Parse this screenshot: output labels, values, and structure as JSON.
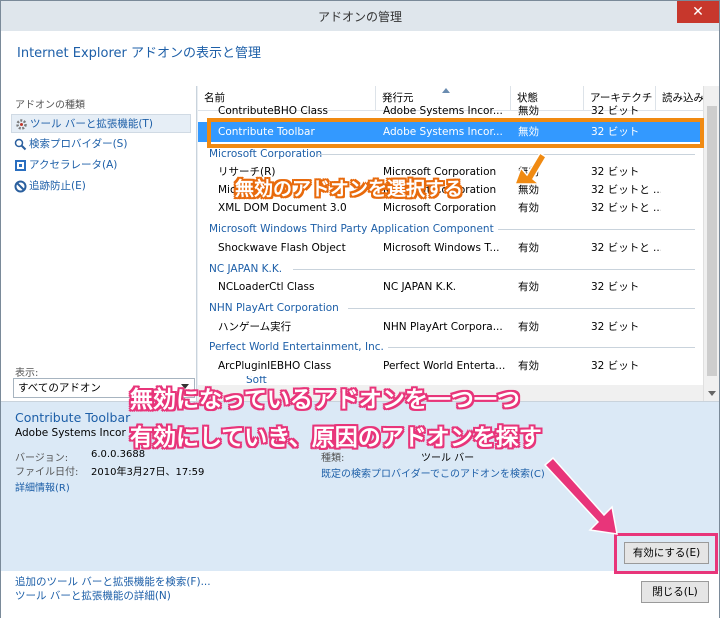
{
  "window": {
    "title": "アドオンの管理",
    "close_glyph": "✕"
  },
  "header": {
    "title": "Internet Explorer アドオンの表示と管理"
  },
  "left_pane": {
    "types_label": "アドオンの種類",
    "types": [
      {
        "label": "ツール バーと拡張機能(T)",
        "icon": "gear-icon",
        "selected": true
      },
      {
        "label": "検索プロバイダー(S)",
        "icon": "search-icon",
        "selected": false
      },
      {
        "label": "アクセラレータ(A)",
        "icon": "accelerator-icon",
        "selected": false
      },
      {
        "label": "追跡防止(E)",
        "icon": "block-icon",
        "selected": false
      }
    ],
    "show_label": "表示:",
    "show_value": "すべてのアドオン"
  },
  "columns": {
    "name": "名前",
    "publisher": "発行元",
    "status": "状態",
    "arch": "アーキテクチャ",
    "load": "読み込み"
  },
  "list": {
    "partial_row": {
      "name": "ContributeBHO Class",
      "publisher": "Adobe Systems Incor...",
      "status": "無効",
      "arch": "32 ビット"
    },
    "selected_row": {
      "name": "Contribute Toolbar",
      "publisher": "Adobe Systems Incor...",
      "status": "無効",
      "arch": "32 ビット"
    },
    "groups": [
      {
        "name": "Microsoft Corporation",
        "rows": [
          {
            "name": "リサーチ(R)",
            "publisher": "Microsoft Corporation",
            "status": "無効",
            "arch": "32 ビット"
          },
          {
            "name": "Mic",
            "publisher": "Microsoft Corporation",
            "status": "無効",
            "arch": "32 ビットと ..."
          },
          {
            "name": "XML DOM Document 3.0",
            "publisher": "Microsoft Corporation",
            "status": "有効",
            "arch": "32 ビットと ..."
          }
        ]
      },
      {
        "name": "Microsoft Windows Third Party Application Component",
        "rows": [
          {
            "name": "Shockwave Flash Object",
            "publisher": "Microsoft Windows T...",
            "status": "有効",
            "arch": "32 ビットと ..."
          }
        ]
      },
      {
        "name": "NC JAPAN K.K.",
        "rows": [
          {
            "name": "NCLoaderCtl Class",
            "publisher": "NC JAPAN K.K.",
            "status": "有効",
            "arch": "32 ビット"
          }
        ]
      },
      {
        "name": "NHN PlayArt Corporation",
        "rows": [
          {
            "name": "ハンゲーム実行",
            "publisher": "NHN PlayArt Corpora...",
            "status": "有効",
            "arch": "32 ビット"
          }
        ]
      },
      {
        "name": "Perfect World Entertainment, Inc.",
        "rows": [
          {
            "name": "ArcPluginIEBHO Class",
            "publisher": "Perfect World Enterta...",
            "status": "有効",
            "arch": "32 ビット"
          }
        ]
      }
    ],
    "partial_bottom": "Soft"
  },
  "details": {
    "name": "Contribute Toolbar",
    "publisher": "Adobe Systems Incor",
    "version_label": "バージョン:",
    "version_value": "6.0.0.3688",
    "date_label": "ファイル日付:",
    "date_value": "2010年3月27日、17:59",
    "more_info": "詳細情報(R)",
    "type_label": "種類:",
    "type_value": "ツール バー",
    "search_link": "既定の検索プロバイダーでこのアドオンを検索(C)"
  },
  "buttons": {
    "enable": "有効にする(E)",
    "close": "閉じる(L)"
  },
  "bottom_links": [
    "追加のツール バーと拡張機能を検索(F)...",
    "ツール バーと拡張機能の詳細(N)"
  ],
  "annotations": {
    "select_disabled": "無効のアドオンを選択する",
    "line1": "無効になっているアドオンを一つ一つ",
    "line2": "有効にしていき、原因のアドオンを探す"
  },
  "colors": {
    "accent_orange": "#f08a12",
    "accent_pink": "#e8357a",
    "selection": "#3399ff",
    "link_blue": "#1d5fa8"
  }
}
